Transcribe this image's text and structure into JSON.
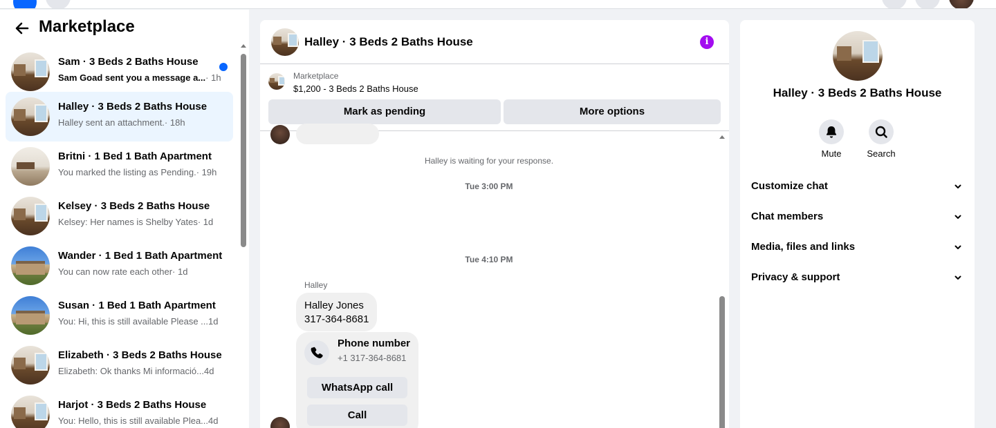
{
  "left": {
    "title": "Marketplace",
    "conversations": [
      {
        "name": "Sam · 3 Beds 2 Baths House",
        "snippet": "Sam Goad sent you a message a...",
        "time": " · 1h",
        "unread": true,
        "thumb": "interior"
      },
      {
        "name": "Halley · 3 Beds 2 Baths House",
        "snippet": "Halley sent an attachment.",
        "time": " · 18h",
        "active": true,
        "thumb": "interior"
      },
      {
        "name": "Britni · 1 Bed 1 Bath Apartment",
        "snippet": "You marked the listing as Pending.",
        "time": " · 19h",
        "thumb": "room"
      },
      {
        "name": "Kelsey · 3 Beds 2 Baths House",
        "snippet": "Kelsey: Her names is Shelby Yates",
        "time": " · 1d",
        "thumb": "interior"
      },
      {
        "name": "Wander · 1 Bed 1 Bath Apartment",
        "snippet": "You can now rate each other",
        "time": " · 1d",
        "thumb": "exterior"
      },
      {
        "name": "Susan · 1 Bed 1 Bath Apartment",
        "snippet": "You: Hi, this is still available Please ...",
        "time": " 1d",
        "thumb": "exterior"
      },
      {
        "name": "Elizabeth · 3 Beds 2 Baths House",
        "snippet": "Elizabeth: Ok thanks Mi informació...",
        "time": " 4d",
        "thumb": "interior"
      },
      {
        "name": "Harjot · 3 Beds 2 Baths House",
        "snippet": "You: Hello, this is still available Plea...",
        "time": " 4d",
        "thumb": "interior"
      }
    ]
  },
  "chat": {
    "title": "Halley · 3 Beds 2 Baths House",
    "listing_source": "Marketplace",
    "listing_price": "$1,200 - 3 Beds 2 Baths House",
    "mark_pending": "Mark as pending",
    "more_options": "More options",
    "waiting": "Halley is waiting for your response.",
    "ts1": "Tue 3:00 PM",
    "ts2": "Tue 4:10 PM",
    "sender": "Halley",
    "message_line1": "Halley Jones",
    "message_line2": "317-364-8681",
    "phone_title": "Phone number",
    "phone_number": "+1 317-364-8681",
    "whatsapp": "WhatsApp call",
    "call": "Call"
  },
  "info": {
    "title": "Halley · 3 Beds 2 Baths House",
    "mute": "Mute",
    "search": "Search",
    "sections": [
      "Customize chat",
      "Chat members",
      "Media, files and links",
      "Privacy & support"
    ]
  },
  "colors": {
    "accent": "#0866ff",
    "info": "#a30cf0",
    "active_bg": "#ebf5ff"
  }
}
